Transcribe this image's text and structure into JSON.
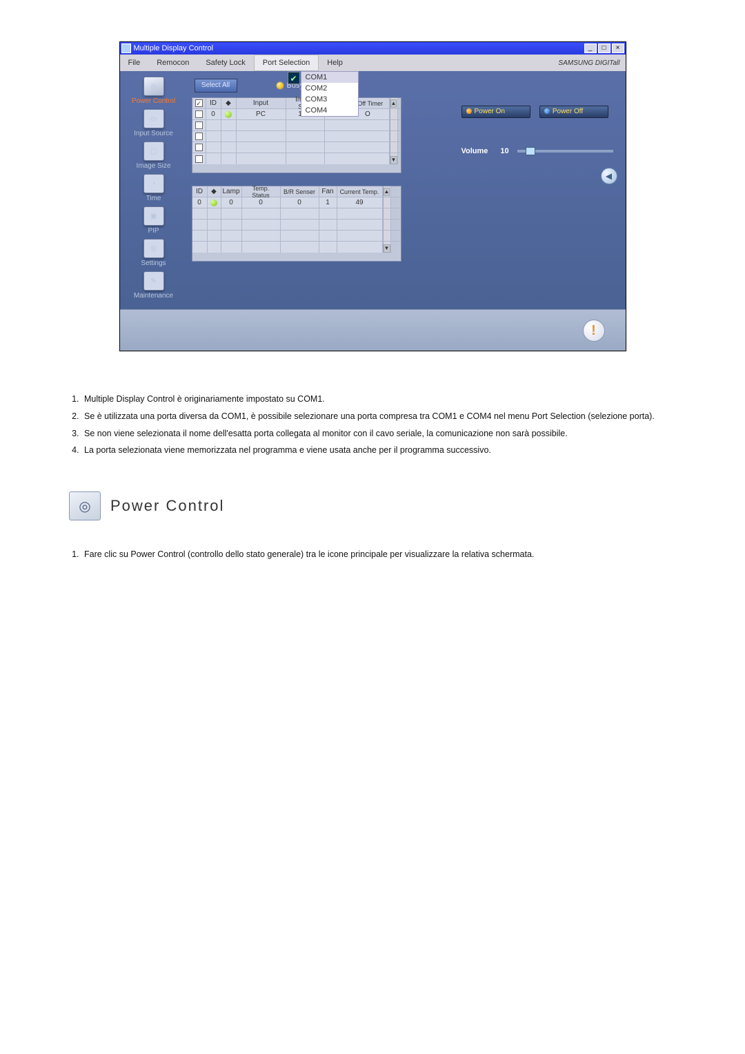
{
  "app": {
    "title": "Multiple Display Control",
    "brand": "SAMSUNG DIGITall"
  },
  "menu": {
    "file": "File",
    "remocon": "Remocon",
    "safety_lock": "Safety Lock",
    "port_selection": "Port Selection",
    "help": "Help"
  },
  "port_menu": {
    "selected": "COM1",
    "items": [
      "COM1",
      "COM2",
      "COM3",
      "COM4"
    ]
  },
  "sidebar": {
    "items": [
      {
        "label": "Power Control"
      },
      {
        "label": "Input Source"
      },
      {
        "label": "Image Size"
      },
      {
        "label": "Time"
      },
      {
        "label": "PIP"
      },
      {
        "label": "Settings"
      },
      {
        "label": "Maintenance"
      }
    ]
  },
  "center": {
    "select_all": "Select All",
    "busy_label": "Busy",
    "grid1": {
      "headers": [
        "",
        "ID",
        "",
        "Input",
        "Image Size",
        "On Timer/Off Timer"
      ],
      "row": {
        "id": "0",
        "input": "PC",
        "image_size": "16:9",
        "timer": "O"
      }
    },
    "grid2": {
      "headers": [
        "ID",
        "",
        "Lamp",
        "Temp. Status",
        "B/R Senser",
        "Fan",
        "Current Temp."
      ],
      "row": {
        "id": "0",
        "lamp": "0",
        "temp_status": "0",
        "br": "0",
        "fan": "1",
        "cur": "49"
      }
    }
  },
  "right": {
    "power_on": "Power On",
    "power_off": "Power Off",
    "volume_label": "Volume",
    "volume_value": "10"
  },
  "doc": {
    "list": [
      "Multiple Display Control è originariamente impostato su COM1.",
      "Se è utilizzata una porta diversa da COM1, è possibile selezionare una porta compresa tra COM1 e COM4 nel menu Port Selection (selezione porta).",
      "Se non viene selezionata il nome dell'esatta porta collegata al monitor con il cavo seriale, la comunicazione non sarà possibile.",
      "La porta selezionata viene memorizzata nel programma e viene usata anche per il programma successivo."
    ],
    "section_title": "Power Control",
    "list2": [
      "Fare clic su Power Control (controllo dello stato generale) tra le icone principale per visualizzare la relativa schermata."
    ]
  }
}
